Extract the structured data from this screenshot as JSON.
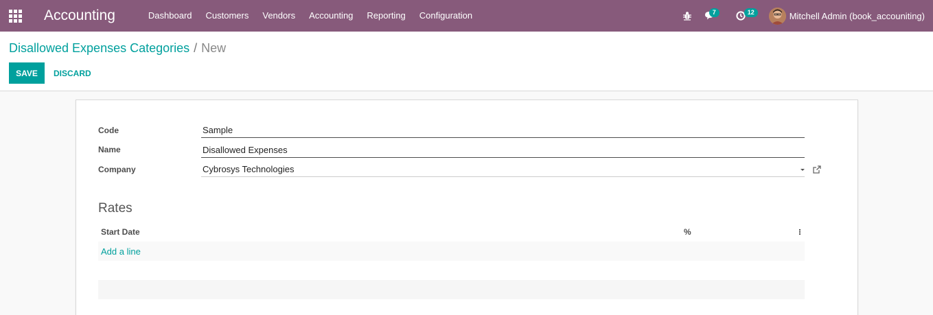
{
  "navbar": {
    "app_name": "Accounting",
    "menu": [
      "Dashboard",
      "Customers",
      "Vendors",
      "Accounting",
      "Reporting",
      "Configuration"
    ],
    "messages_count": "7",
    "activities_count": "12",
    "user_name": "Mitchell Admin (book_accouniting)"
  },
  "breadcrumb": {
    "parent": "Disallowed Expenses Categories",
    "separator": "/",
    "current": "New"
  },
  "buttons": {
    "save": "SAVE",
    "discard": "DISCARD"
  },
  "form": {
    "code_label": "Code",
    "code_value": "Sample",
    "name_label": "Name",
    "name_value": "Disallowed Expenses",
    "company_label": "Company",
    "company_value": "Cybrosys Technologies"
  },
  "rates": {
    "title": "Rates",
    "columns": [
      "Start Date",
      "%"
    ],
    "add_line": "Add a line"
  },
  "colors": {
    "navbar": "#875a7b",
    "accent": "#00a09d"
  }
}
